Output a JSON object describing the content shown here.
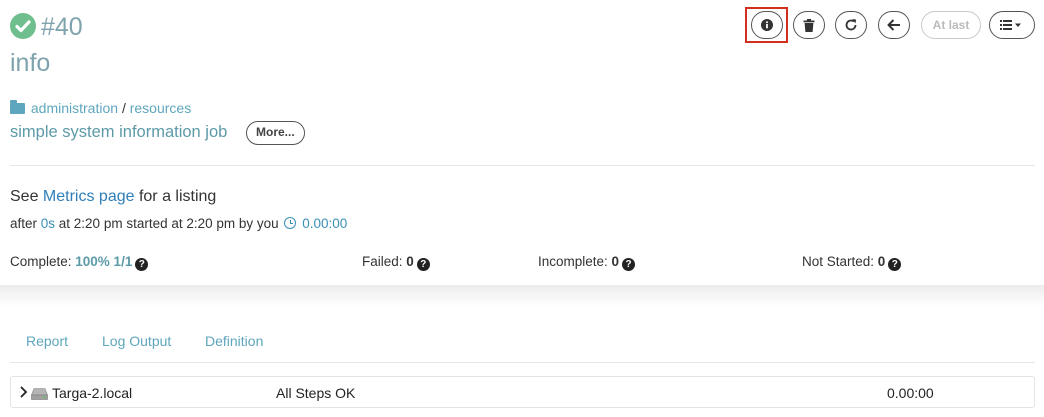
{
  "header": {
    "execution_number": "#40",
    "job_name": "info",
    "breadcrumb": {
      "group": "administration",
      "separator": "/",
      "subgroup": "resources"
    },
    "description": "simple system information job",
    "more_label": "More..."
  },
  "toolbar": {
    "info_icon": "info-circle-icon",
    "delete_icon": "trash-icon",
    "refresh_icon": "refresh-icon",
    "back_icon": "arrow-left-icon",
    "at_last_label": "At last",
    "menu_icon": "list-menu-icon",
    "highlight_color": "#d32f1e"
  },
  "execution": {
    "see_prefix": "See ",
    "metrics_link": "Metrics page",
    "see_suffix": " for a listing",
    "after_prefix": "after ",
    "after_value": "0s",
    "at_text": " at 2:20 pm started at 2:20 pm by you",
    "duration": "0.00:00"
  },
  "stats": {
    "complete_label": "Complete: ",
    "complete_value": "100% 1/1",
    "failed_label": "Failed: ",
    "failed_value": "0",
    "incomplete_label": "Incomplete: ",
    "incomplete_value": "0",
    "not_started_label": "Not Started: ",
    "not_started_value": "0",
    "help_glyph": "?"
  },
  "tabs": [
    {
      "label": "Report"
    },
    {
      "label": "Log Output"
    },
    {
      "label": "Definition"
    }
  ],
  "nodes": [
    {
      "name": "Targa-2.local",
      "status": "All Steps OK",
      "duration": "0.00:00"
    }
  ],
  "colors": {
    "accent": "#5d9aa8",
    "link": "#3a8fb7",
    "success": "#6fbf8e"
  }
}
